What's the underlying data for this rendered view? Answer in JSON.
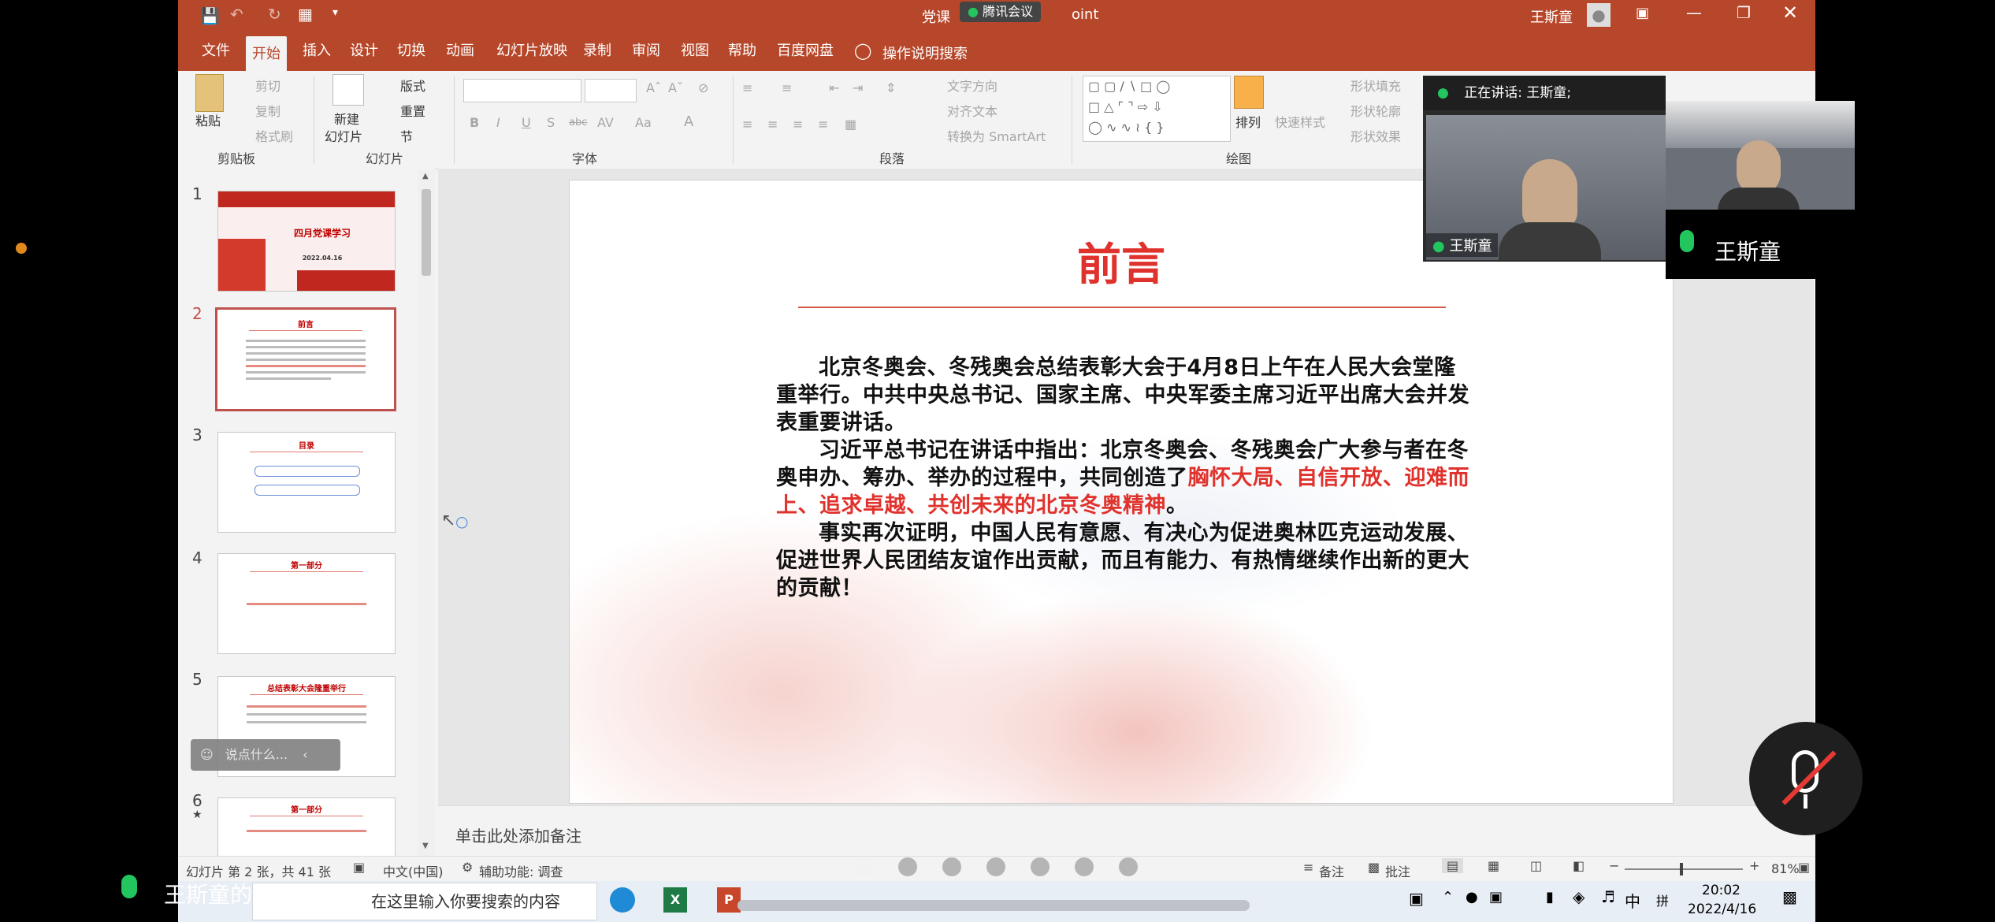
{
  "window": {
    "title_left": "党课",
    "title_right": "oint",
    "meeting_badge": "腾讯会议",
    "user": "王斯童"
  },
  "ribbon_tabs": [
    "文件",
    "开始",
    "插入",
    "设计",
    "切换",
    "动画",
    "幻灯片放映",
    "录制",
    "审阅",
    "视图",
    "帮助",
    "百度网盘"
  ],
  "ribbon_search": "操作说明搜索",
  "clipboard": {
    "paste": "粘贴",
    "cut": "剪切",
    "copy": "复制",
    "format": "格式刷",
    "group": "剪贴板"
  },
  "slides_group": {
    "new": "新建",
    "new2": "幻灯片",
    "layout": "版式",
    "reset": "重置",
    "section": "节",
    "group": "幻灯片"
  },
  "font_group": {
    "group": "字体",
    "bold": "B",
    "italic": "I",
    "underline": "U",
    "shadow": "S",
    "strike": "abc",
    "spacing": "AV",
    "case": "Aa",
    "color": "A"
  },
  "paragraph_group": {
    "group": "段落",
    "text_dir": "文字方向",
    "align_text": "对齐文本",
    "smartart": "转换为 SmartArt"
  },
  "drawing_group": {
    "group": "绘图",
    "arrange": "排列",
    "quick_styles": "快速样式",
    "fill": "形状填充",
    "outline": "形状轮廓",
    "effects": "形状效果"
  },
  "thumbnails": [
    {
      "num": "1",
      "title": "四月党课学习",
      "sub": "2022.04.16"
    },
    {
      "num": "2",
      "title": "前言"
    },
    {
      "num": "3",
      "title": "目录"
    },
    {
      "num": "4",
      "title": "第一部分"
    },
    {
      "num": "5",
      "title": "总结表彰大会隆重举行"
    },
    {
      "num": "6",
      "title": "第一部分",
      "star": "★"
    }
  ],
  "slide": {
    "title": "前言",
    "p1": "北京冬奥会、冬残奥会总结表彰大会于4月8日上午在人民大会堂隆重举行。中共中央总书记、国家主席、中央军委主席习近平出席大会并发表重要讲话。",
    "p2_pre": "习近平总书记在讲话中指出：北京冬奥会、冬残奥会广大参与者在冬奥申办、筹办、举办的过程中，共同创造了",
    "p2_red": "胸怀大局、自信开放、迎难而上、追求卓越、共创未来的北京冬奥精神",
    "p2_post": "。",
    "p3": "事实再次证明，中国人民有意愿、有决心为促进奥林匹克运动发展、促进世界人民团结友谊作出贡献，而且有能力、有热情继续作出新的更大的贡献！"
  },
  "notes_placeholder": "单击此处添加备注",
  "chat_input": "说点什么...",
  "status": {
    "slide_info": "幻灯片 第 2 张，共 41 张",
    "lang": "中文(中国)",
    "accessibility": "辅助功能: 调查",
    "notes": "备注",
    "comments": "批注",
    "zoom": "81%"
  },
  "meeting": {
    "speaking": "正在讲话: 王斯童;",
    "tile_name": "王斯童",
    "self_name": "王斯童",
    "share_banner": "王斯童的屏幕共享"
  },
  "taskbar": {
    "search": "在这里输入你要搜索的内容",
    "ime": "中",
    "ime2": "拼",
    "time": "20:02",
    "date": "2022/4/16"
  },
  "colors": {
    "accent": "#b7472a",
    "slide_red": "#e0322c",
    "meeting_green": "#22c55e"
  }
}
